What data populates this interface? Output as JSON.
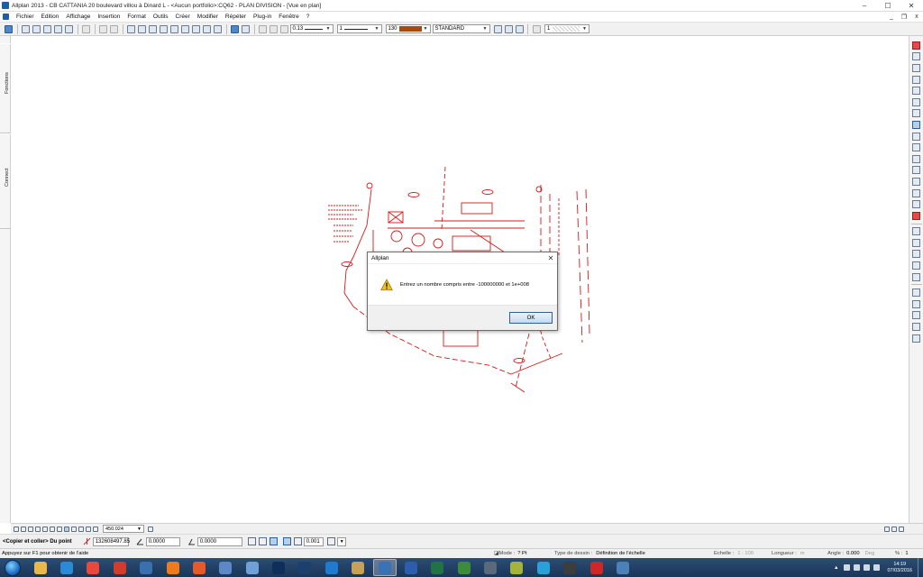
{
  "window": {
    "title": "Allplan 2013 - CB CATTANIA  20 boulevard villou à Dinard L - <Aucun portfolio>:CQ62 - PLAN DIVISION - [Vue en plan]",
    "minimize": "–",
    "maximize": "☐",
    "close": "✕"
  },
  "menu": {
    "items": [
      "Fichier",
      "Edition",
      "Affichage",
      "Insertion",
      "Format",
      "Outils",
      "Créer",
      "Modifier",
      "Répéter",
      "Plug-in",
      "Fenêtre",
      "?"
    ],
    "mdi_min": "_",
    "mdi_restore": "❐",
    "mdi_close": "x"
  },
  "toolbar": {
    "pen_value": "0.13",
    "line_value": "1",
    "color_value": "130",
    "layer_value": "STANDARD",
    "hatch_value": "1"
  },
  "side_tabs": [
    "Fonctions",
    "Connect"
  ],
  "dialog": {
    "title": "Allplan",
    "close": "✕",
    "message": "Entrez un nombre compris entre -100000000 et 1e+008",
    "ok": "OK"
  },
  "coord_bar": {
    "precision_value": "450.024",
    "prompt": "<Copier et coller> Du point",
    "dx": "132608497.85",
    "dy": "0.0000",
    "dz": "0.0000",
    "snap_value": "0.001"
  },
  "status_bar": {
    "help": "Appuyez sur F1 pour obtenir de l'aide",
    "mode_label": "Mode :",
    "mode_value": "? Pt",
    "drawing_type_label": "Type de dessin :",
    "drawing_type_value": "Définition de l'échelle",
    "scale_label": "Echelle :",
    "scale_value": "1 : 100",
    "length_label": "Longueur :",
    "length_value": "m",
    "angle_label": "Angle :",
    "angle_value": "0.000",
    "angle_unit": "Deg",
    "percent_label": "% :",
    "percent_value": "1"
  },
  "taskbar": {
    "apps": [
      {
        "name": "explorer",
        "color": "#e8b84a"
      },
      {
        "name": "internet-explorer",
        "color": "#2a8ad6"
      },
      {
        "name": "chrome",
        "color": "#e9483e"
      },
      {
        "name": "ccleaner",
        "color": "#d23c2c"
      },
      {
        "name": "unknown-blue",
        "color": "#3a6fb0"
      },
      {
        "name": "firefox",
        "color": "#f07b1b"
      },
      {
        "name": "paint",
        "color": "#e55a2b"
      },
      {
        "name": "mail",
        "color": "#5d88c8"
      },
      {
        "name": "notepad",
        "color": "#6fa1d8"
      },
      {
        "name": "photoshop",
        "color": "#0e2f59"
      },
      {
        "name": "cinema4d",
        "color": "#1d3f6e"
      },
      {
        "name": "teamviewer",
        "color": "#1f7ad2"
      },
      {
        "name": "files",
        "color": "#c7a15a"
      },
      {
        "name": "allplan",
        "color": "#3b71b5"
      },
      {
        "name": "word",
        "color": "#2b5fad"
      },
      {
        "name": "excel",
        "color": "#217346"
      },
      {
        "name": "sketchup",
        "color": "#3c8c3c"
      },
      {
        "name": "generic-app",
        "color": "#596a7d"
      },
      {
        "name": "w-app",
        "color": "#a4b43a"
      },
      {
        "name": "flash",
        "color": "#2aa0d8"
      },
      {
        "name": "game",
        "color": "#3d3d3d"
      },
      {
        "name": "acrobat",
        "color": "#cf2727"
      },
      {
        "name": "remote-desktop",
        "color": "#4d7fb8"
      }
    ],
    "time": "14:19",
    "date": "07/03/2016"
  }
}
